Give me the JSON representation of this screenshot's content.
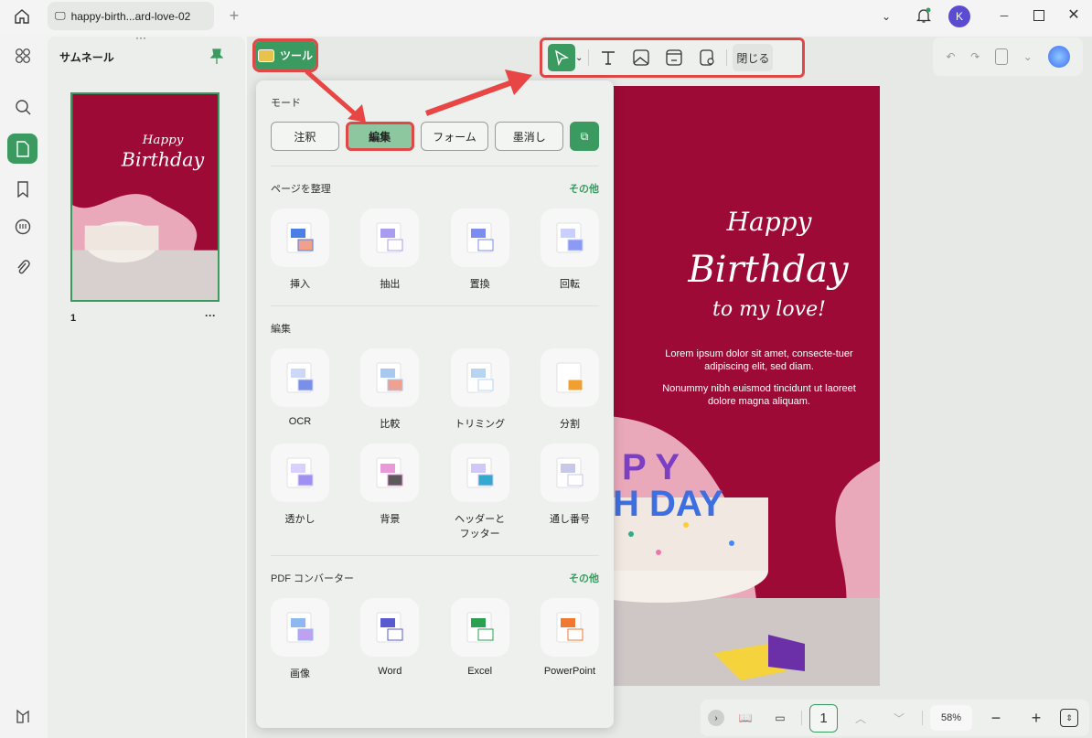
{
  "tab": {
    "title": "happy-birth...ard-love-02"
  },
  "user": {
    "initial": "K"
  },
  "thumbnails": {
    "title": "サムネール",
    "page_label": "1",
    "more": "···"
  },
  "tools_button": "ツール",
  "toolbar": {
    "close": "閉じる"
  },
  "panel": {
    "mode_title": "モード",
    "modes": [
      "注釈",
      "編集",
      "フォーム",
      "墨消し"
    ],
    "active_mode": "編集",
    "sections": [
      {
        "title": "ページを整理",
        "more": "その他",
        "items": [
          "挿入",
          "抽出",
          "置換",
          "回転"
        ]
      },
      {
        "title": "編集",
        "more": "",
        "items": [
          "OCR",
          "比較",
          "トリミング",
          "分割",
          "透かし",
          "背景",
          "ヘッダーとフッター",
          "通し番号"
        ]
      },
      {
        "title": "PDF コンバーター",
        "more": "その他",
        "items": [
          "画像",
          "Word",
          "Excel",
          "PowerPoint"
        ]
      }
    ]
  },
  "document": {
    "line1": "Happy",
    "line2": "Birthday",
    "line3": "to my love!",
    "para1": "Lorem ipsum dolor sit amet, consecte-tuer adipiscing elit, sed diam.",
    "para2": "Nonummy nibh euismod tincidunt ut laoreet dolore magna aliquam."
  },
  "bottom": {
    "page": "1",
    "zoom": "58%"
  },
  "colors": {
    "accent": "#3b9a5f",
    "highlight": "#e04848",
    "crimson": "#9c0a35",
    "pink": "#eaa9ba"
  }
}
